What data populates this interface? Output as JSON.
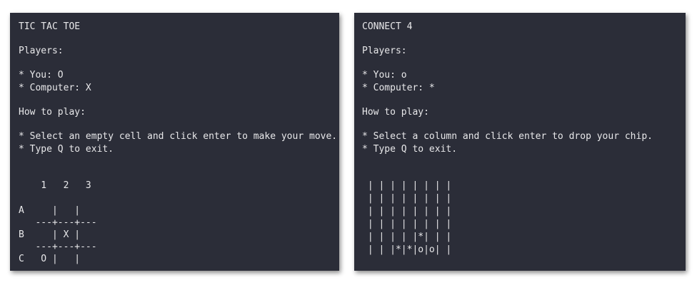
{
  "tic_tac_toe": {
    "title": "TIC TAC TOE",
    "players_heading": "Players:",
    "player_you": "* You: O",
    "player_computer": "* Computer: X",
    "howto_heading": "How to play:",
    "instructions": [
      "* Select an empty cell and click enter to make your move.",
      "* Type Q to exit."
    ],
    "board_lines": [
      "    1   2   3",
      "A     |   |",
      "   ---+---+---",
      "B     | X |",
      "   ---+---+---",
      "C   O |   |"
    ],
    "cells": {
      "A": [
        "",
        "",
        ""
      ],
      "B": [
        "",
        "X",
        ""
      ],
      "C": [
        "O",
        "",
        ""
      ]
    }
  },
  "connect_4": {
    "title": "CONNECT 4",
    "players_heading": "Players:",
    "player_you": "* You: o",
    "player_computer": "* Computer: *",
    "howto_heading": "How to play:",
    "instructions": [
      "* Select a column and click enter to drop your chip.",
      "* Type Q to exit."
    ],
    "board_lines": [
      " | | | | | | | |",
      " | | | | | | | |",
      " | | | | | | | |",
      " | | | | | | | |",
      " | | | | |*| | |",
      " | | |*|*|o|o| |"
    ]
  }
}
